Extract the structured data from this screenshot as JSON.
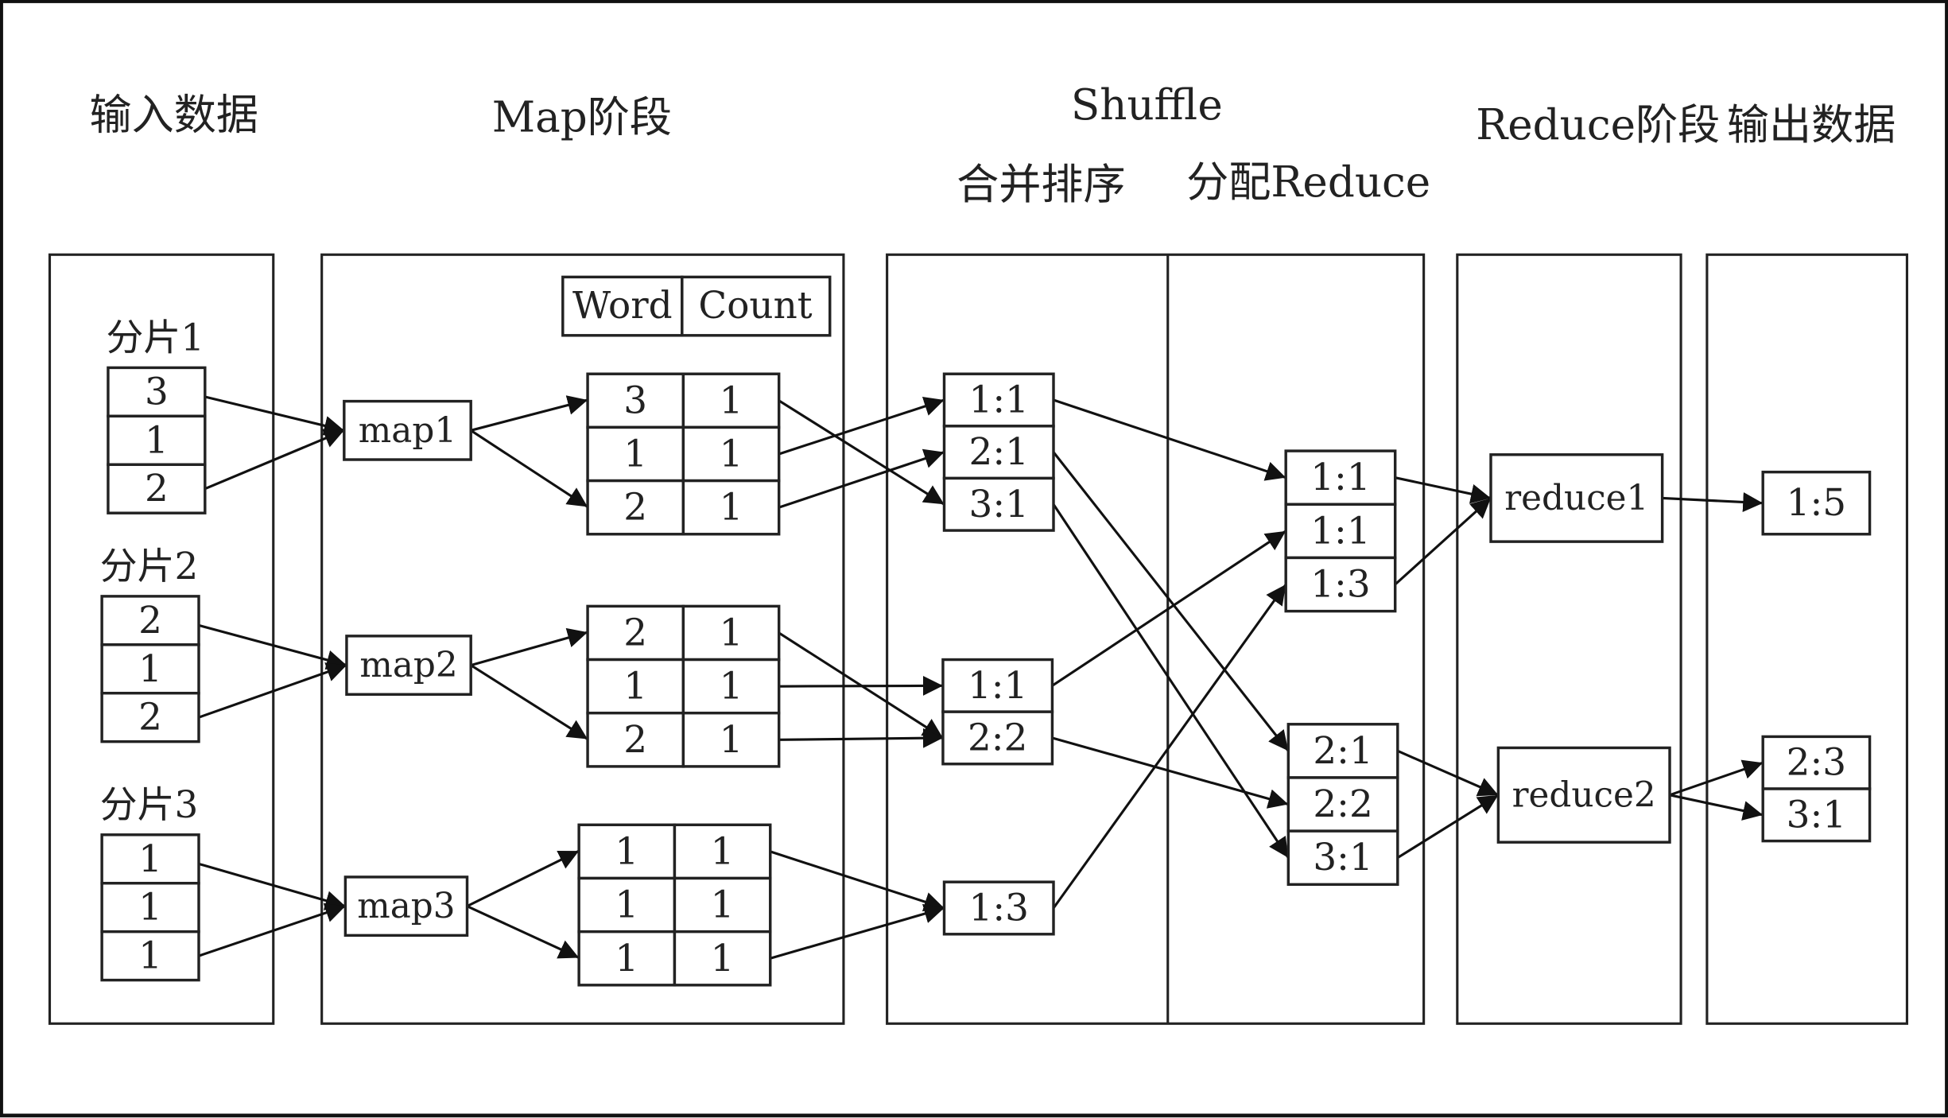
{
  "headers": {
    "input": "输入数据",
    "map": "Map阶段",
    "shuffle": "Shuffle",
    "merge_sort": "合并排序",
    "assign_reduce": "分配Reduce",
    "reduce": "Reduce阶段",
    "output": "输出数据"
  },
  "input": {
    "splits": [
      {
        "label": "分片1",
        "values": [
          "3",
          "1",
          "2"
        ]
      },
      {
        "label": "分片2",
        "values": [
          "2",
          "1",
          "2"
        ]
      },
      {
        "label": "分片3",
        "values": [
          "1",
          "1",
          "1"
        ]
      }
    ]
  },
  "map": {
    "legend": {
      "word": "Word",
      "count": "Count"
    },
    "mappers": [
      {
        "label": "map1",
        "rows": [
          [
            "3",
            "1"
          ],
          [
            "1",
            "1"
          ],
          [
            "2",
            "1"
          ]
        ]
      },
      {
        "label": "map2",
        "rows": [
          [
            "2",
            "1"
          ],
          [
            "1",
            "1"
          ],
          [
            "2",
            "1"
          ]
        ]
      },
      {
        "label": "map3",
        "rows": [
          [
            "1",
            "1"
          ],
          [
            "1",
            "1"
          ],
          [
            "1",
            "1"
          ]
        ]
      }
    ]
  },
  "shuffle": {
    "sorted": [
      [
        "1:1",
        "2:1",
        "3:1"
      ],
      [
        "1:1",
        "2:2"
      ],
      [
        "1:3"
      ]
    ],
    "assigned": [
      [
        "1:1",
        "1:1",
        "1:3"
      ],
      [
        "2:1",
        "2:2",
        "3:1"
      ]
    ]
  },
  "reduce": {
    "reducers": [
      "reduce1",
      "reduce2"
    ]
  },
  "output": {
    "results": [
      [
        "1:5"
      ],
      [
        "2:3",
        "3:1"
      ]
    ]
  }
}
